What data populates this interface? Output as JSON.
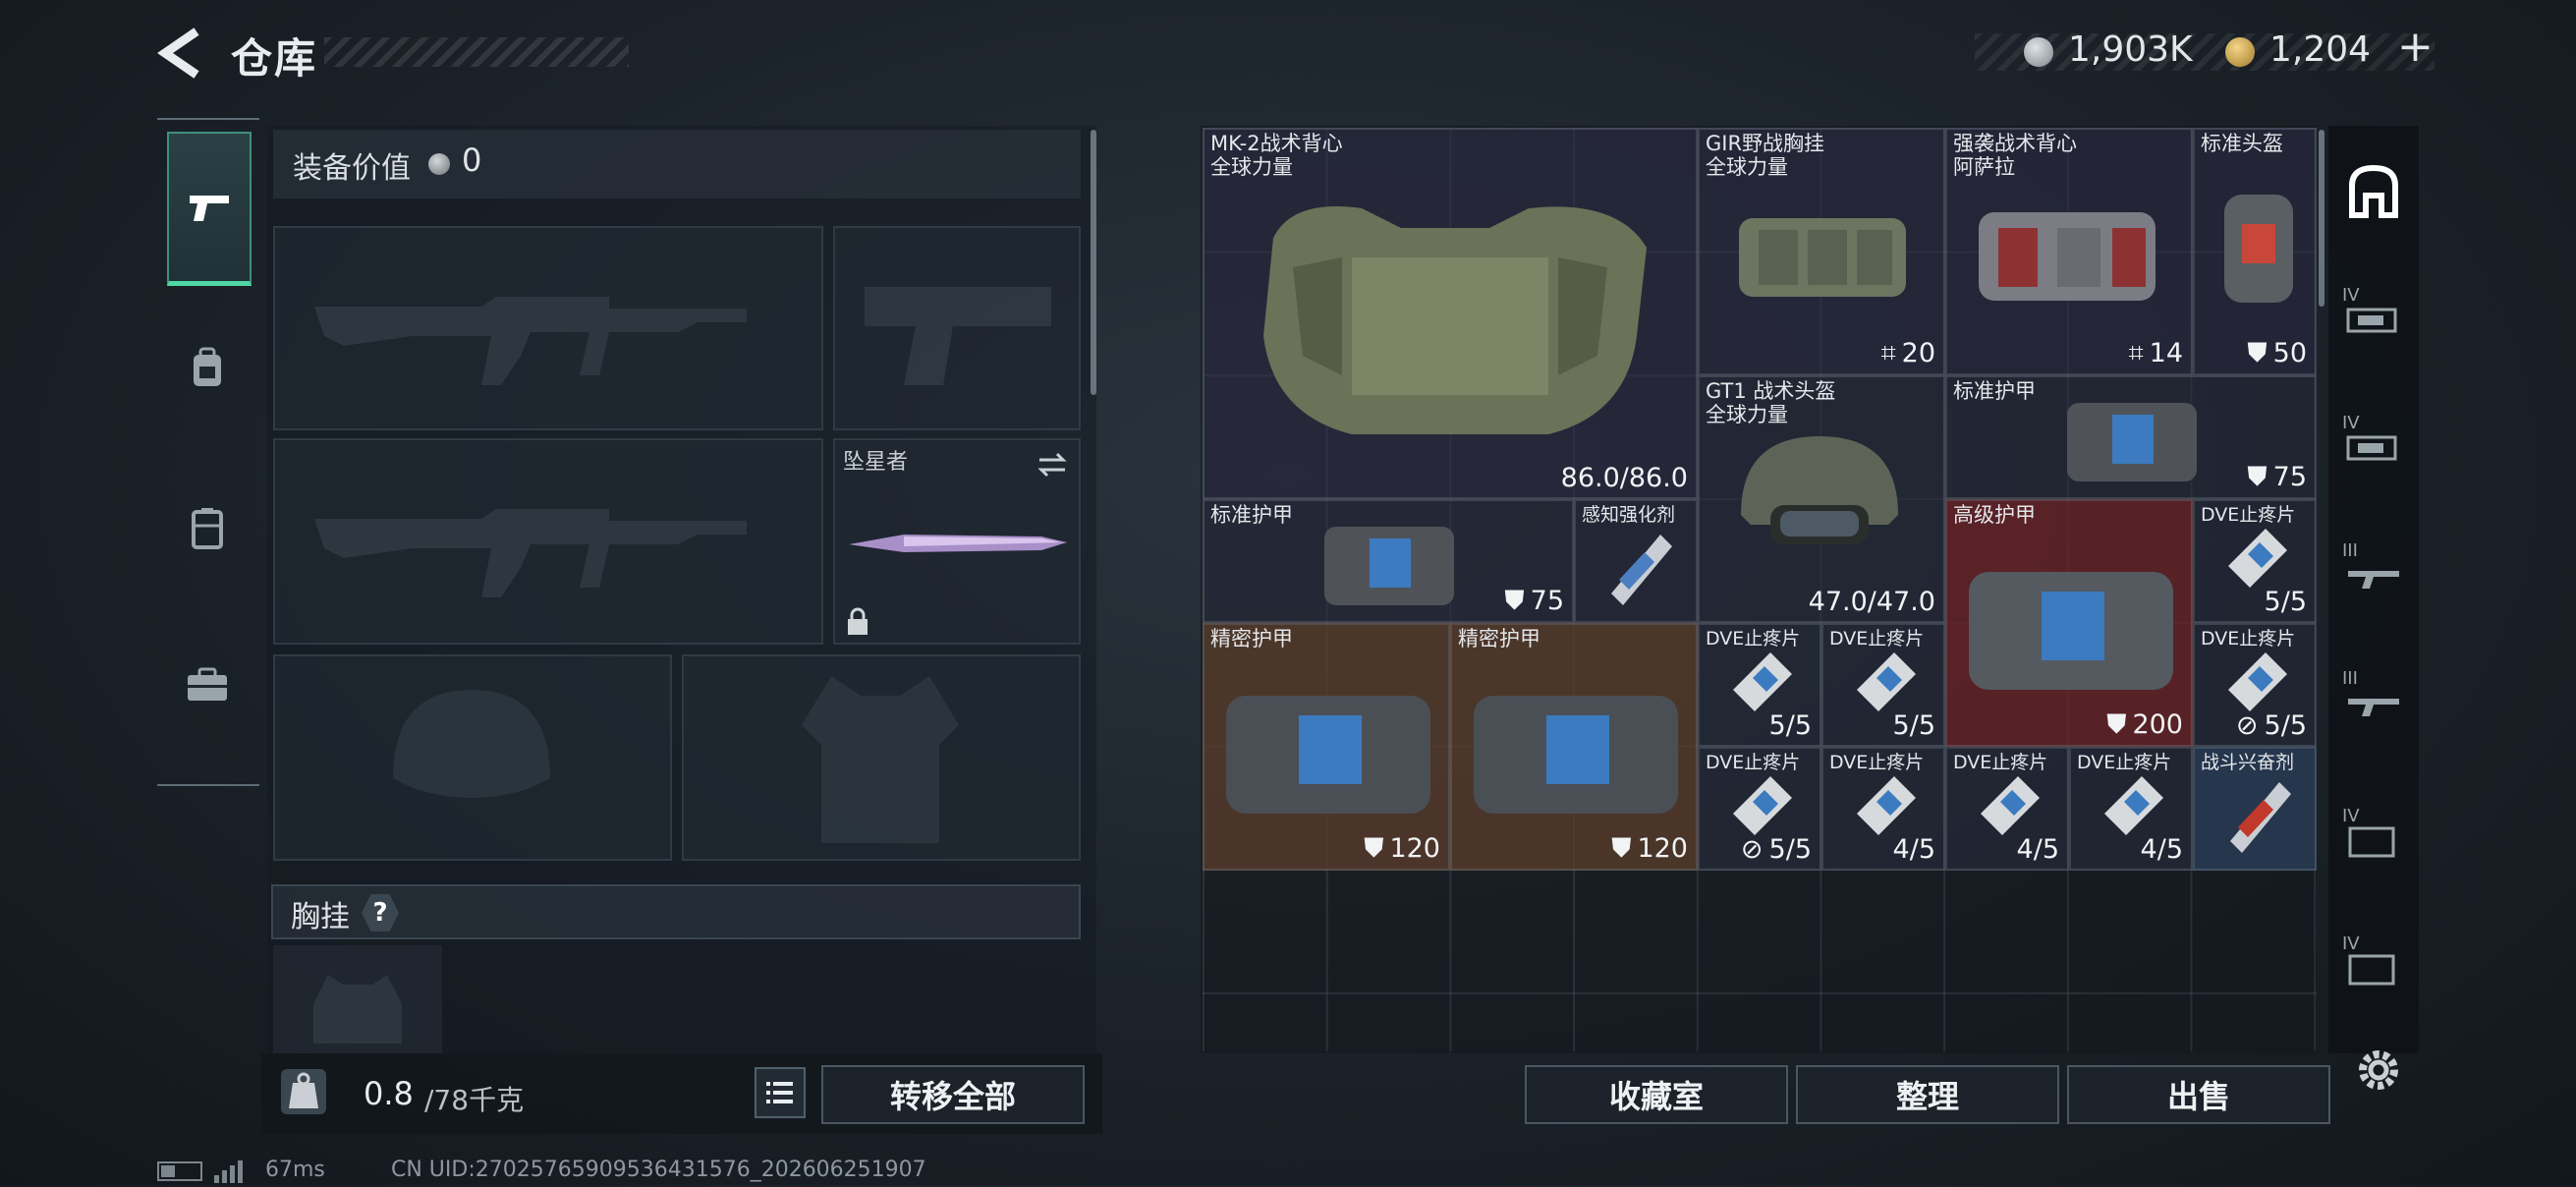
{
  "header": {
    "title": "仓库",
    "currency_silver": "1,903K",
    "currency_gold": "1,204",
    "currency_add": "+"
  },
  "left_panel": {
    "equip_value_label": "装备价值",
    "equip_value": "0",
    "melee_slot_label": "坠星者",
    "chest_label": "胸挂",
    "chest_help": "?"
  },
  "bottom_left": {
    "weight_value": "0.8",
    "weight_unit": "/78千克",
    "transfer_all_label": "转移全部"
  },
  "grid_items": [
    {
      "name": "MK-2战术背心",
      "sub": "全球力量",
      "value": "86.0/86.0"
    },
    {
      "name": "GIR野战胸挂",
      "sub": "全球力量",
      "value": "20"
    },
    {
      "name": "强袭战术背心",
      "sub": "阿萨拉",
      "value": "14"
    },
    {
      "name": "标准头盔",
      "sub": "",
      "value": "50"
    },
    {
      "name": "GT1 战术头盔",
      "sub": "全球力量",
      "value": "47.0/47.0"
    },
    {
      "name": "标准护甲",
      "sub": "",
      "value": "75"
    },
    {
      "name": "标准护甲",
      "sub": "",
      "value": "75"
    },
    {
      "name": "感知强化剂",
      "sub": "",
      "value": ""
    },
    {
      "name": "高级护甲",
      "sub": "",
      "value": "200"
    },
    {
      "name": "DVE止疼片",
      "sub": "",
      "value": "5/5"
    },
    {
      "name": "精密护甲",
      "sub": "",
      "value": "120"
    },
    {
      "name": "精密护甲",
      "sub": "",
      "value": "120"
    },
    {
      "name": "DVE止疼片",
      "sub": "",
      "value": "5/5"
    },
    {
      "name": "DVE止疼片",
      "sub": "",
      "value": "5/5"
    },
    {
      "name": "DVE止疼片",
      "sub": "",
      "value": "5/5"
    },
    {
      "name": "DVE止疼片",
      "sub": "",
      "value": "5/5"
    },
    {
      "name": "DVE止疼片",
      "sub": "",
      "value": "4/5"
    },
    {
      "name": "DVE止疼片",
      "sub": "",
      "value": "4/5"
    },
    {
      "name": "DVE止疼片",
      "sub": "",
      "value": "4/5"
    },
    {
      "name": "战斗兴奋剂",
      "sub": "",
      "value": ""
    }
  ],
  "tool_column": {
    "tiers": [
      "IV",
      "IV",
      "III",
      "III",
      "IV",
      "IV"
    ]
  },
  "bottom_right": {
    "collection_label": "收藏室",
    "organize_label": "整理",
    "sell_label": "出售"
  },
  "footer": {
    "ping": "67ms",
    "uid": "CN UID:27025765909536431576_202606251907"
  },
  "colors": {
    "accent_green": "#4fd7a5",
    "cell_purple": "#302e48",
    "cell_brown": "#5c3e2c",
    "cell_red": "#6e2428",
    "cell_blue": "#2c405c"
  }
}
